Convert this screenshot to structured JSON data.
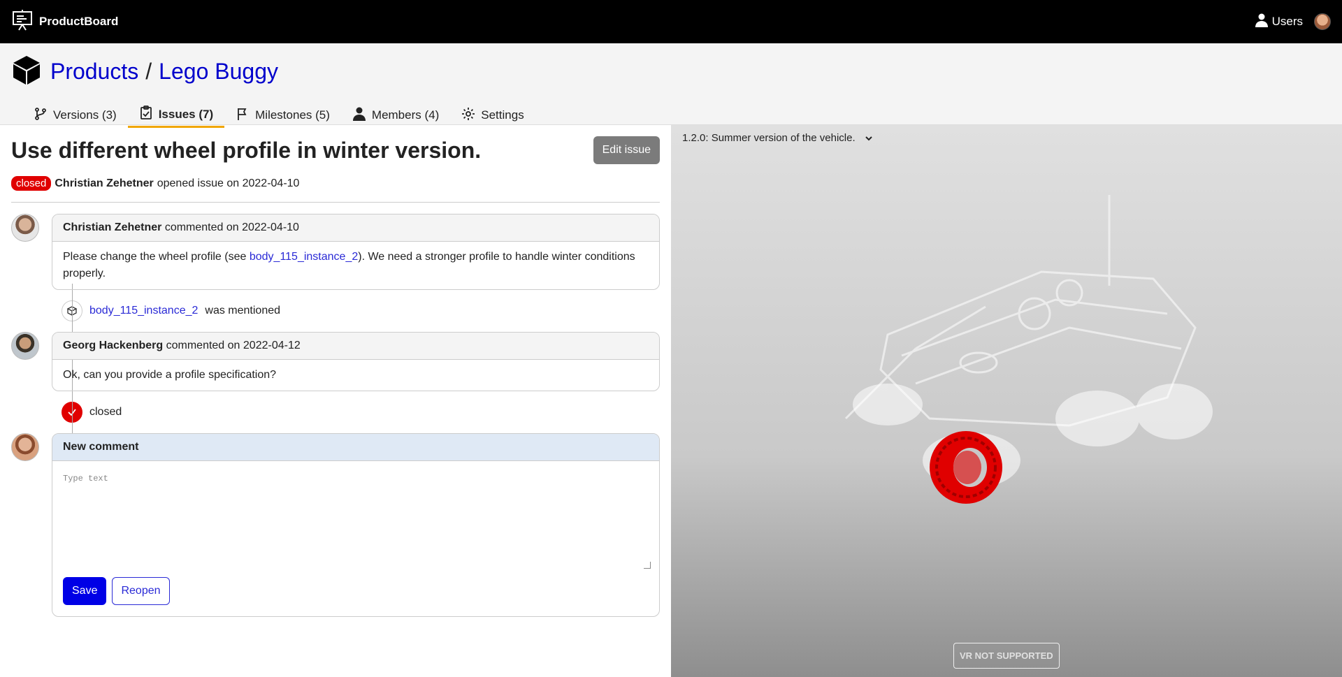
{
  "app": {
    "name": "ProductBoard"
  },
  "topbar": {
    "users_label": "Users"
  },
  "breadcrumb": {
    "root": "Products",
    "separator": "/",
    "current": "Lego Buggy"
  },
  "tabs": [
    {
      "label": "Versions (3)",
      "icon": "branch-icon"
    },
    {
      "label": "Issues (7)",
      "icon": "clipboard-check-icon",
      "active": true
    },
    {
      "label": "Milestones (5)",
      "icon": "flag-icon"
    },
    {
      "label": "Members (4)",
      "icon": "person-icon"
    },
    {
      "label": "Settings",
      "icon": "gear-icon"
    }
  ],
  "issue": {
    "title": "Use different wheel profile in winter version.",
    "edit_label": "Edit issue",
    "status": "closed",
    "author": "Christian Zehetner",
    "opened_text": "opened issue on 2022-04-10"
  },
  "comments": [
    {
      "author": "Christian Zehetner",
      "meta": "commented on 2022-04-10",
      "text_before": "Please change the wheel profile (see ",
      "link": "body_115_instance_2",
      "text_after": "). We need a stronger profile to handle winter conditions properly."
    },
    {
      "author": "Georg Hackenberg",
      "meta": "commented on 2022-04-12",
      "text": "Ok, can you provide a profile specification?"
    }
  ],
  "events": {
    "mention": {
      "link": "body_115_instance_2",
      "text": "was mentioned"
    },
    "closed": {
      "text": "closed"
    }
  },
  "new_comment": {
    "title": "New comment",
    "placeholder": "Type text",
    "save_label": "Save",
    "reopen_label": "Reopen"
  },
  "viewer": {
    "version_label": "1.2.0: Summer version of the vehicle.",
    "vr_label": "VR NOT SUPPORTED",
    "highlight_color": "#e00000"
  },
  "colors": {
    "accent_link": "#0000cc",
    "tab_underline": "#f0a600",
    "closed_badge": "#e00000",
    "save_button": "#0000e6"
  }
}
